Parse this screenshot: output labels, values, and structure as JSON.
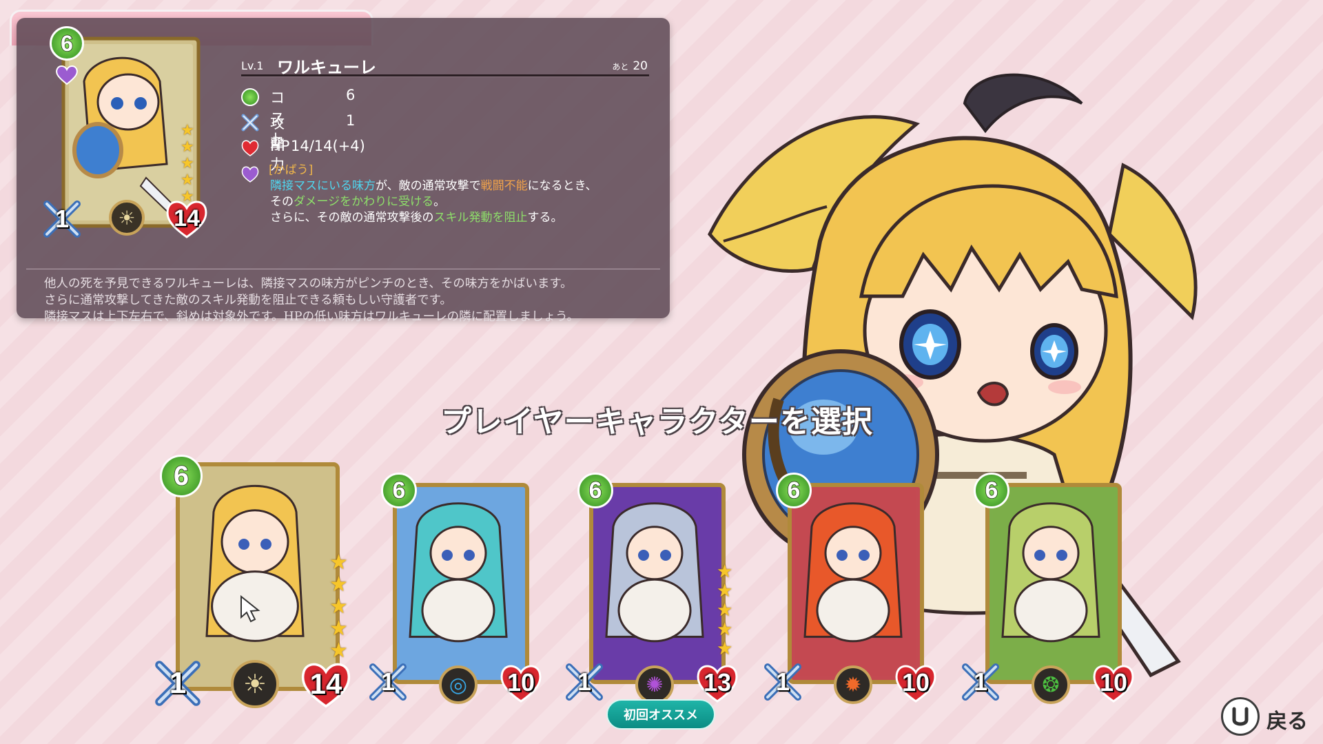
{
  "detail": {
    "level": "Lv.1",
    "name": "ワルキューレ",
    "remaining_label": "あと",
    "remaining_value": "20",
    "cost_badge": "6",
    "atk_badge": "1",
    "hp_badge": "14",
    "stats": {
      "cost_label": "コスト",
      "cost_value": "6",
      "attack_label": "攻撃力",
      "attack_value": "1",
      "hp_label": "HP",
      "hp_value": "14/14(+4)"
    },
    "skill": {
      "name": "[かばう]",
      "l1_a": "隣接マスにいる味方",
      "l1_b": "が、敵の通常攻撃で",
      "l1_c": "戦闘不能",
      "l1_d": "になるとき、",
      "l2_a": "その",
      "l2_b": "ダメージをかわりに受ける",
      "l2_c": "。",
      "l3_a": "さらに、その敵の通常攻撃後の",
      "l3_b": "スキル発動を阻止",
      "l3_c": "する。"
    },
    "description": [
      "他人の死を予見できるワルキューレは、隣接マスの味方がピンチのとき、その味方をかばいます。",
      "さらに通常攻撃してきた敵のスキル発動を阻止できる頼もしい守護者です。",
      "隣接マスは上下左右で、斜めは対象外です。HPの低い味方はワルキューレの隣に配置しましょう。"
    ]
  },
  "title": "プレイヤーキャラクターを選択",
  "cards": [
    {
      "cost": "6",
      "atk": "1",
      "hp": "14",
      "element": "light",
      "element_color": "#e9d8a0",
      "bg": "#cfc08a",
      "hair": "#f2c451",
      "stars": 5,
      "selected": true
    },
    {
      "cost": "6",
      "atk": "1",
      "hp": "10",
      "element": "water",
      "element_color": "#38a8e8",
      "bg": "#6ea6e0",
      "hair": "#4fc6c9",
      "stars": 0,
      "selected": false
    },
    {
      "cost": "6",
      "atk": "1",
      "hp": "13",
      "element": "dark",
      "element_color": "#b052d8",
      "bg": "#6a3ca8",
      "hair": "#b9c4da",
      "stars": 5,
      "selected": false
    },
    {
      "cost": "6",
      "atk": "1",
      "hp": "10",
      "element": "fire",
      "element_color": "#f06a2a",
      "bg": "#c44a52",
      "hair": "#e8582a",
      "stars": 0,
      "selected": false
    },
    {
      "cost": "6",
      "atk": "1",
      "hp": "10",
      "element": "wind",
      "element_color": "#4cc040",
      "bg": "#7cae4a",
      "hair": "#b8cf6a",
      "stars": 0,
      "selected": false
    }
  ],
  "recommend_label": "初回オススメ",
  "back_label": "戻る",
  "colors": {
    "panel": "#5c4854",
    "accent": "#0b8d84",
    "background": "#f3d9de"
  }
}
